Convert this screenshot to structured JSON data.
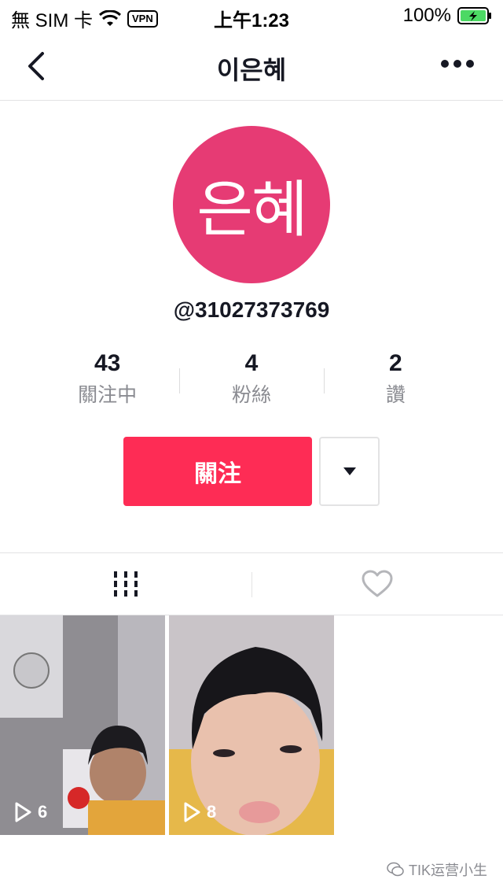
{
  "status_bar": {
    "carrier": "無 SIM 卡",
    "vpn": "VPN",
    "time": "上午1:23",
    "battery": "100%"
  },
  "nav": {
    "title": "이은혜"
  },
  "profile": {
    "avatar_text": "은혜",
    "avatar_color": "#e63b74",
    "handle": "@31027373769"
  },
  "stats": [
    {
      "value": "43",
      "label": "關注中"
    },
    {
      "value": "4",
      "label": "粉絲"
    },
    {
      "value": "2",
      "label": "讚"
    }
  ],
  "actions": {
    "follow_label": "關注",
    "follow_color": "#fe2c55"
  },
  "tabs": [
    {
      "icon": "grid-icon",
      "active": true
    },
    {
      "icon": "heart-icon",
      "active": false
    }
  ],
  "videos": [
    {
      "plays": "6"
    },
    {
      "plays": "8"
    }
  ],
  "watermark": "TIK运营小生"
}
